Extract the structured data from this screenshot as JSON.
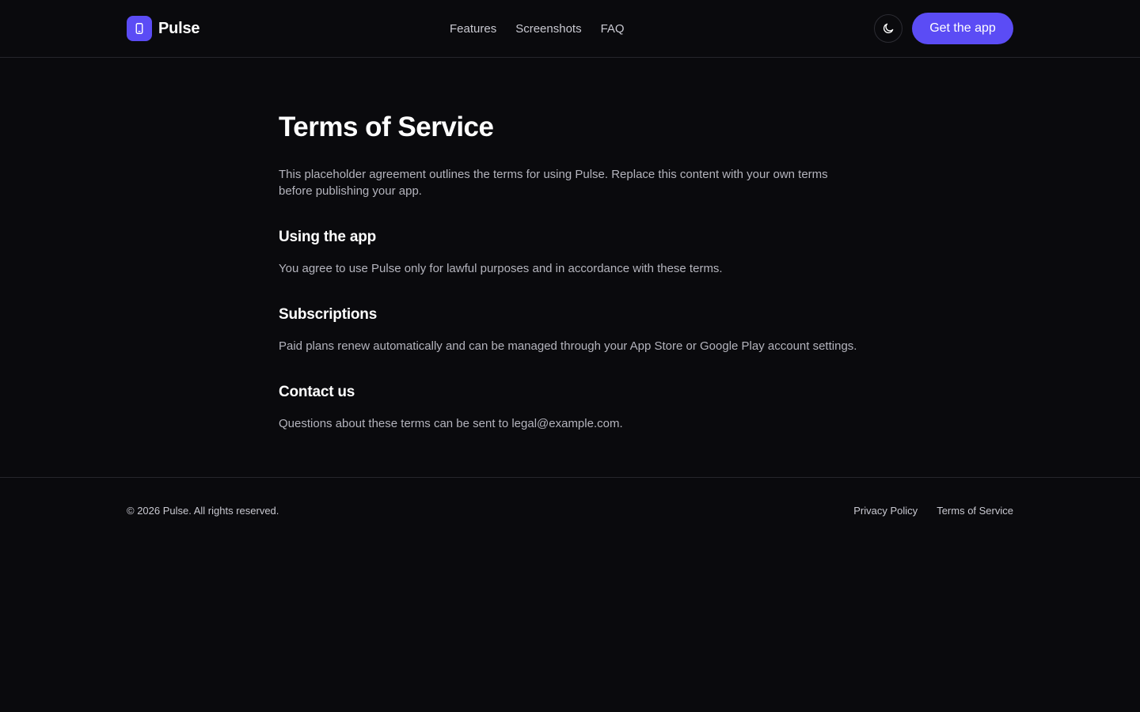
{
  "header": {
    "brand": "Pulse",
    "brand_icon": "phone-icon",
    "nav": [
      "Features",
      "Screenshots",
      "FAQ"
    ],
    "theme_icon": "moon-icon",
    "cta_label": "Get the app"
  },
  "main": {
    "title": "Terms of Service",
    "intro": "This placeholder agreement outlines the terms for using Pulse. Replace this content with your own terms before publishing your app.",
    "sections": [
      {
        "heading": "Using the app",
        "body": "You agree to use Pulse only for lawful purposes and in accordance with these terms."
      },
      {
        "heading": "Subscriptions",
        "body": "Paid plans renew automatically and can be managed through your App Store or Google Play account settings."
      },
      {
        "heading": "Contact us",
        "body": "Questions about these terms can be sent to legal@example.com."
      }
    ]
  },
  "footer": {
    "copyright": "© 2026 Pulse. All rights reserved.",
    "links": [
      "Privacy Policy",
      "Terms of Service"
    ]
  },
  "colors": {
    "accent": "#5b4cf5",
    "background": "#0a0a0d",
    "border": "#26262c",
    "muted_text": "#b4b4bd"
  }
}
